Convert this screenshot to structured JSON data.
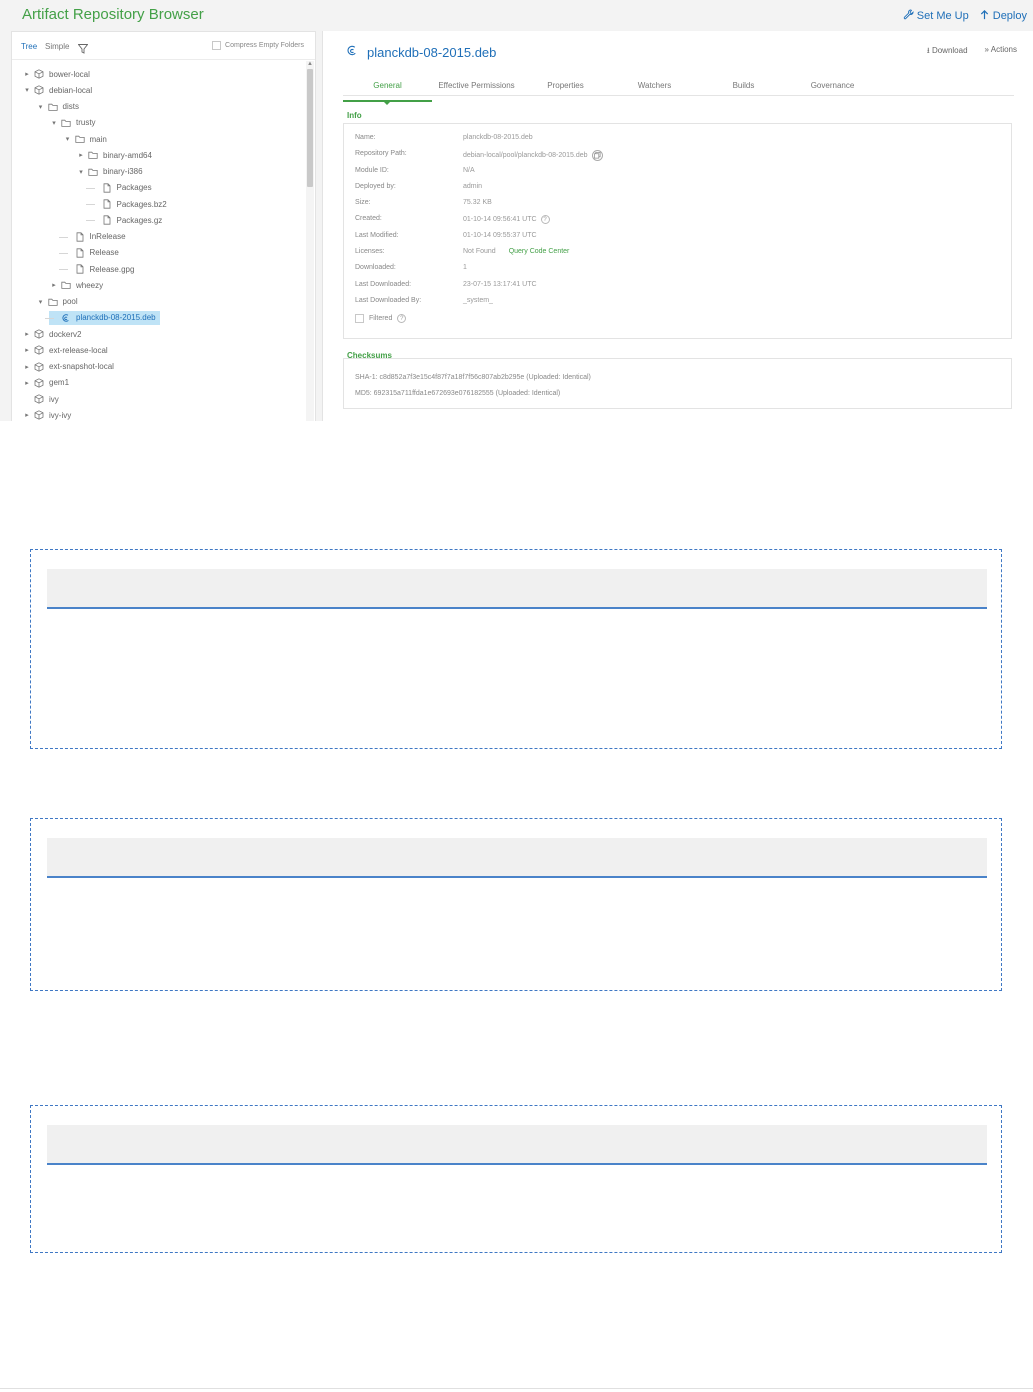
{
  "app": {
    "title": "Artifact Repository Browser",
    "set_me_up": "Set Me Up",
    "deploy": "Deploy"
  },
  "tree": {
    "mode_tree": "Tree",
    "mode_simple": "Simple",
    "compress_label": "Compress Empty Folders",
    "nodes": [
      {
        "label": "bower-local",
        "icon": "repo-icon",
        "caret": "right"
      },
      {
        "label": "debian-local",
        "icon": "repo-icon",
        "caret": "down"
      },
      {
        "label": "dists",
        "icon": "folder-icon",
        "caret": "down"
      },
      {
        "label": "trusty",
        "icon": "folder-icon",
        "caret": "down"
      },
      {
        "label": "main",
        "icon": "folder-icon",
        "caret": "down"
      },
      {
        "label": "binary-amd64",
        "icon": "folder-icon",
        "caret": "right"
      },
      {
        "label": "binary-i386",
        "icon": "folder-icon",
        "caret": "down"
      },
      {
        "label": "Packages",
        "icon": "file-icon",
        "caret": ""
      },
      {
        "label": "Packages.bz2",
        "icon": "file-icon",
        "caret": ""
      },
      {
        "label": "Packages.gz",
        "icon": "file-icon",
        "caret": ""
      },
      {
        "label": "InRelease",
        "icon": "file-icon",
        "caret": ""
      },
      {
        "label": "Release",
        "icon": "file-icon",
        "caret": ""
      },
      {
        "label": "Release.gpg",
        "icon": "file-icon",
        "caret": ""
      },
      {
        "label": "wheezy",
        "icon": "folder-icon",
        "caret": "right"
      },
      {
        "label": "pool",
        "icon": "folder-icon",
        "caret": "down"
      },
      {
        "label": "planckdb-08-2015.deb",
        "icon": "debian-icon",
        "caret": "",
        "selected": true
      },
      {
        "label": "dockerv2",
        "icon": "repo-icon",
        "caret": "right"
      },
      {
        "label": "ext-release-local",
        "icon": "repo-icon",
        "caret": "right"
      },
      {
        "label": "ext-snapshot-local",
        "icon": "repo-icon",
        "caret": "right"
      },
      {
        "label": "gem1",
        "icon": "repo-icon",
        "caret": "right"
      },
      {
        "label": "ivy",
        "icon": "repo-icon",
        "caret": ""
      },
      {
        "label": "ivy-ivy",
        "icon": "repo-icon",
        "caret": "right"
      }
    ]
  },
  "detail": {
    "file_name": "planckdb-08-2015.deb",
    "download": "Download",
    "actions": "Actions",
    "tabs": [
      "General",
      "Effective Permissions",
      "Properties",
      "Watchers",
      "Builds",
      "Governance"
    ],
    "active_tab": "General",
    "info_title": "Info",
    "info": [
      {
        "label": "Name:",
        "value": "planckdb-08-2015.deb"
      },
      {
        "label": "Repository Path:",
        "value": "debian-local/pool/planckdb-08-2015.deb"
      },
      {
        "label": "Module ID:",
        "value": "N/A"
      },
      {
        "label": "Deployed by:",
        "value": "admin"
      },
      {
        "label": "Size:",
        "value": "75.32 KB"
      },
      {
        "label": "Created:",
        "value": "01-10-14 09:56:41 UTC"
      },
      {
        "label": "Last Modified:",
        "value": "01-10-14 09:55:37 UTC"
      },
      {
        "label": "Licenses:",
        "value": "Not Found"
      },
      {
        "label": "Downloaded:",
        "value": "1"
      },
      {
        "label": "Last Downloaded:",
        "value": "23-07-15 13:17:41 UTC"
      },
      {
        "label": "Last Downloaded By:",
        "value": "_system_"
      }
    ],
    "query_code_center": "Query Code Center",
    "filtered_label": "Filtered",
    "checksums_title": "Checksums",
    "sha1": "SHA-1: c8d852a7f3e15c4f87f7a18f7f56c807ab2b295e (Uploaded: Identical)",
    "md5": "MD5: 692315a711ffda1e672693e076182555 (Uploaded: Identical)"
  },
  "colors": {
    "brand_green": "#43a047",
    "link_blue": "#1f6fb8",
    "selection": "#bfe3f6",
    "placeholder_border": "#3f78c4"
  }
}
